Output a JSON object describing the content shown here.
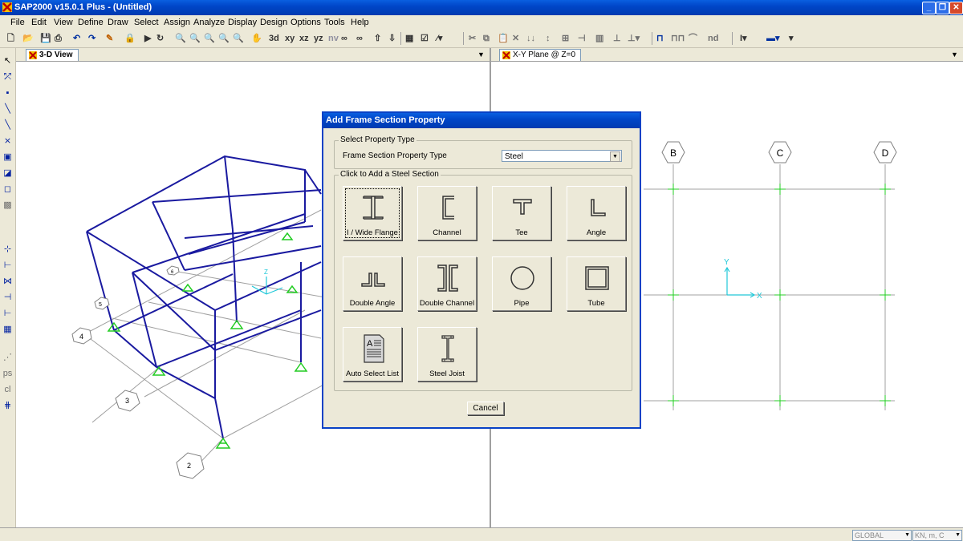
{
  "window": {
    "title": "SAP2000 v15.0.1 Plus  - (Untitled)"
  },
  "menu": [
    "File",
    "Edit",
    "View",
    "Define",
    "Draw",
    "Select",
    "Assign",
    "Analyze",
    "Display",
    "Design",
    "Options",
    "Tools",
    "Help"
  ],
  "toolbar": {
    "view_buttons": [
      "xy",
      "xz",
      "yz",
      "nv"
    ],
    "nd_label": "nd"
  },
  "panes": {
    "left_tab": "3-D View",
    "right_tab": "X-Y Plane @ Z=0",
    "right_grid_bubbles": [
      "B",
      "C",
      "D"
    ],
    "axis_labels": {
      "y": "Y",
      "x": "X",
      "z": "Z"
    },
    "left_grid_bubbles": [
      "2",
      "3",
      "4",
      "5",
      "6"
    ]
  },
  "dialog": {
    "title": "Add Frame Section Property",
    "group1_legend": "Select Property Type",
    "property_type_label": "Frame Section Property Type",
    "property_type_value": "Steel",
    "group2_legend": "Click to Add a Steel Section",
    "sections": [
      {
        "label": "I / Wide Flange",
        "icon": "i-beam-icon"
      },
      {
        "label": "Channel",
        "icon": "channel-icon"
      },
      {
        "label": "Tee",
        "icon": "tee-icon"
      },
      {
        "label": "Angle",
        "icon": "angle-icon"
      },
      {
        "label": "Double Angle",
        "icon": "double-angle-icon"
      },
      {
        "label": "Double Channel",
        "icon": "double-channel-icon"
      },
      {
        "label": "Pipe",
        "icon": "pipe-icon"
      },
      {
        "label": "Tube",
        "icon": "tube-icon"
      },
      {
        "label": "Auto Select List",
        "icon": "list-document-icon"
      },
      {
        "label": "Steel Joist",
        "icon": "steel-joist-icon"
      }
    ],
    "cancel_label": "Cancel"
  },
  "status": {
    "coord_system": "GLOBAL",
    "units": "KN, m, C"
  },
  "colors": {
    "frame": "#1a1aa0",
    "support": "#22cc22",
    "grid": "#a0a0a0",
    "axis": "#20c8d8",
    "titlebar": "#0046c8"
  }
}
